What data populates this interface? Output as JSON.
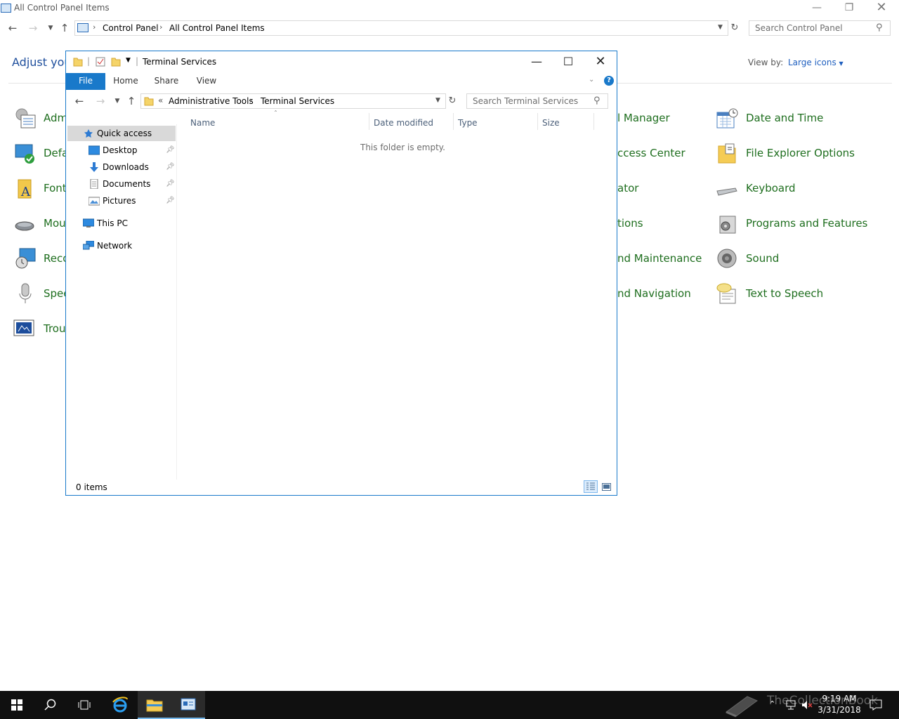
{
  "control_panel": {
    "window_title": "All Control Panel Items",
    "breadcrumb": [
      "Control Panel",
      "All Control Panel Items"
    ],
    "search_placeholder": "Search Control Panel",
    "heading": "Adjust you",
    "view_by_label": "View by:",
    "view_by_value": "Large icons",
    "items_left": [
      "Adm",
      "Defa",
      "Font",
      "Mou",
      "Reco",
      "Spee",
      "Trou"
    ],
    "items_middle": [
      "l Manager",
      "ccess Center",
      "ator",
      "tions",
      "nd Maintenance",
      "nd Navigation"
    ],
    "items_right": [
      "Date and Time",
      "File Explorer Options",
      "Keyboard",
      "Programs and Features",
      "Sound",
      "Text to Speech"
    ]
  },
  "explorer": {
    "window_title": "Terminal Services",
    "ribbon_tabs": [
      "File",
      "Home",
      "Share",
      "View"
    ],
    "path_overflow": "«",
    "path": [
      "Administrative Tools",
      "Terminal Services"
    ],
    "search_placeholder": "Search Terminal Services",
    "nav_items": {
      "quick_access": "Quick access",
      "desktop": "Desktop",
      "downloads": "Downloads",
      "documents": "Documents",
      "pictures": "Pictures",
      "this_pc": "This PC",
      "network": "Network"
    },
    "columns": [
      "Name",
      "Date modified",
      "Type",
      "Size"
    ],
    "empty_message": "This folder is empty.",
    "status_count": "0 items"
  },
  "taskbar": {
    "time": "9:19 AM",
    "date": "3/31/2018",
    "watermark": "TheCollectionBook"
  },
  "colors": {
    "accent": "#1979ca",
    "cp_link_green": "#1e6e1e",
    "taskbar_bg": "#101010"
  }
}
